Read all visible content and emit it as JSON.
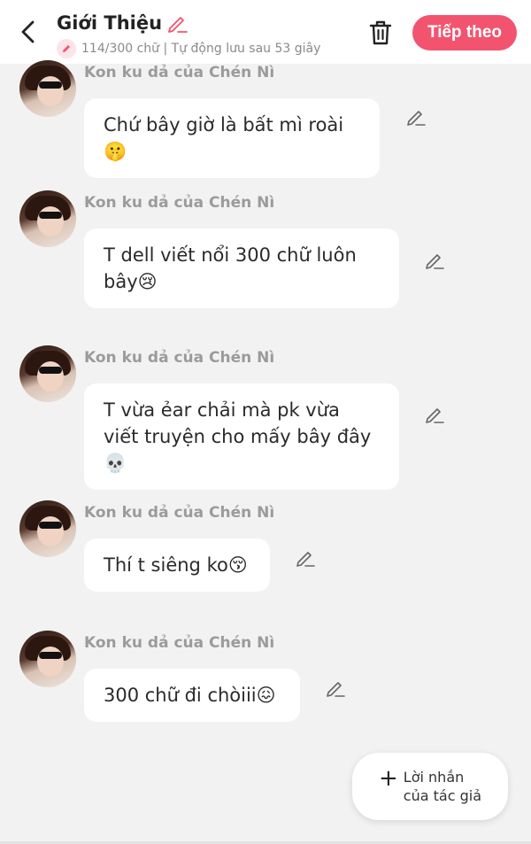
{
  "header": {
    "title": "Giới Thiệu",
    "status": "114/300 chữ | Tự động lưu sau 53 giây",
    "next_label": "Tiếp theo"
  },
  "messages": [
    {
      "author": "Kon ku dả của Chén Nì",
      "text": "Chứ bây giờ là bất mì roài🤫"
    },
    {
      "author": "Kon ku dả của Chén Nì",
      "text": "T dell viết nổi 300 chữ luôn bây😢"
    },
    {
      "author": "Kon ku dả của Chén Nì",
      "text": "T vừa ẻar chải mà pk vừa viết truyện cho mấy bây đây💀"
    },
    {
      "author": "Kon ku dả của Chén Nì",
      "text": "Thí t siêng ko😚"
    },
    {
      "author": "Kon ku dả của Chén Nì",
      "text": "300 chữ đi chòiii😖"
    }
  ],
  "note_button": {
    "line1": "Lời nhắn",
    "line2": "của tác giả"
  },
  "colors": {
    "accent": "#f2546f",
    "background": "#f2f2f2",
    "bubble": "#ffffff",
    "author": "#9b9b9b"
  },
  "icons": [
    "back-arrow-icon",
    "pencil-icon",
    "trash-icon",
    "plus-icon"
  ]
}
